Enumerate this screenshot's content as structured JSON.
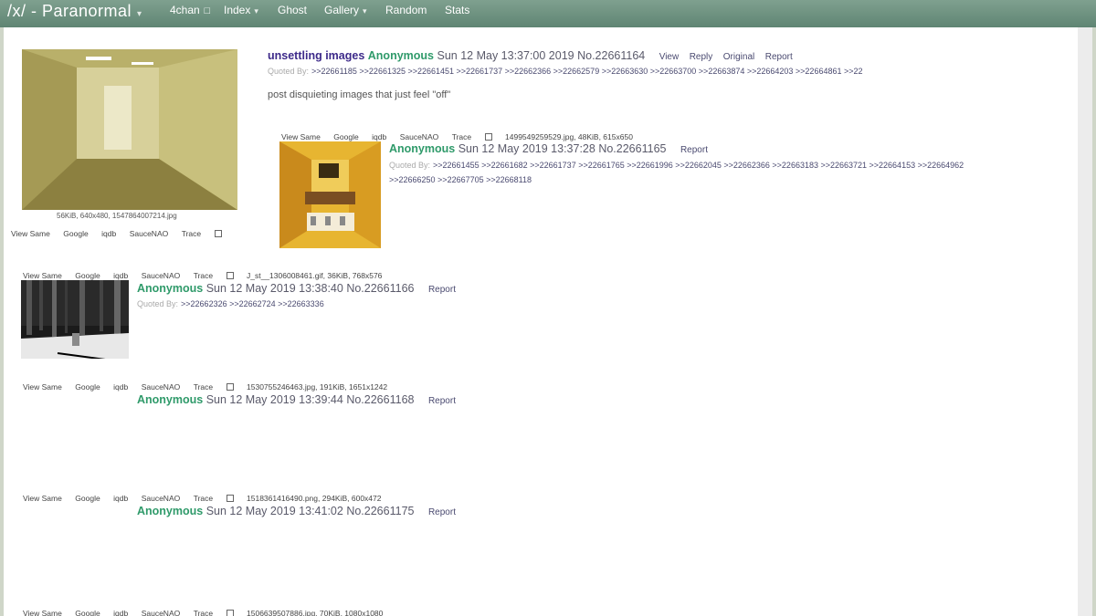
{
  "nav": {
    "brand": "/x/ - Paranormal",
    "items": [
      "4chan",
      "Index",
      "Ghost",
      "Gallery",
      "Random",
      "Stats"
    ]
  },
  "tools": [
    "View Same",
    "Google",
    "iqdb",
    "SauceNAO",
    "Trace"
  ],
  "op": {
    "image_info": "56KiB, 640x480, 1547864007214.jpg",
    "subject": "unsettling images",
    "name": "Anonymous",
    "date": "Sun 12 May 13:37:00 2019",
    "number": "No.22661164",
    "links": [
      "View",
      "Reply",
      "Original",
      "Report"
    ],
    "quoted_label": "Quoted By:",
    "quoted": ">>22661185 >>22661325 >>22661451 >>22661737 >>22662366 >>22662579 >>22663630 >>22663700 >>22663874 >>22664203 >>22664861 >>22",
    "comment": "post disquieting images that just feel \"off\""
  },
  "replies": [
    {
      "file": "1499549259529.jpg, 48KiB, 615x650",
      "name": "Anonymous",
      "date": "Sun 12 May 2019 13:37:28",
      "number": "No.22661165",
      "report": "Report",
      "quoted_label": "Quoted By:",
      "quoted_line1": ">>22661455 >>22661682 >>22661737 >>22661765 >>22661996 >>22662045 >>22662366 >>22663183 >>22663721 >>22664153 >>22664962",
      "quoted_line2": ">>22666250 >>22667705 >>22668118"
    },
    {
      "file": "J_st__1306008461.gif, 36KiB, 768x576",
      "name": "Anonymous",
      "date": "Sun 12 May 2019 13:38:40",
      "number": "No.22661166",
      "report": "Report",
      "quoted_label": "Quoted By:",
      "quoted": ">>22662326 >>22662724 >>22663336"
    },
    {
      "file": "1530755246463.jpg, 191KiB, 1651x1242",
      "name": "Anonymous",
      "date": "Sun 12 May 2019 13:39:44",
      "number": "No.22661168",
      "report": "Report"
    },
    {
      "file": "1518361416490.png, 294KiB, 600x472",
      "name": "Anonymous",
      "date": "Sun 12 May 2019 13:41:02",
      "number": "No.22661175",
      "report": "Report"
    },
    {
      "file": "1506639507886.jpg, 70KiB, 1080x1080"
    }
  ]
}
